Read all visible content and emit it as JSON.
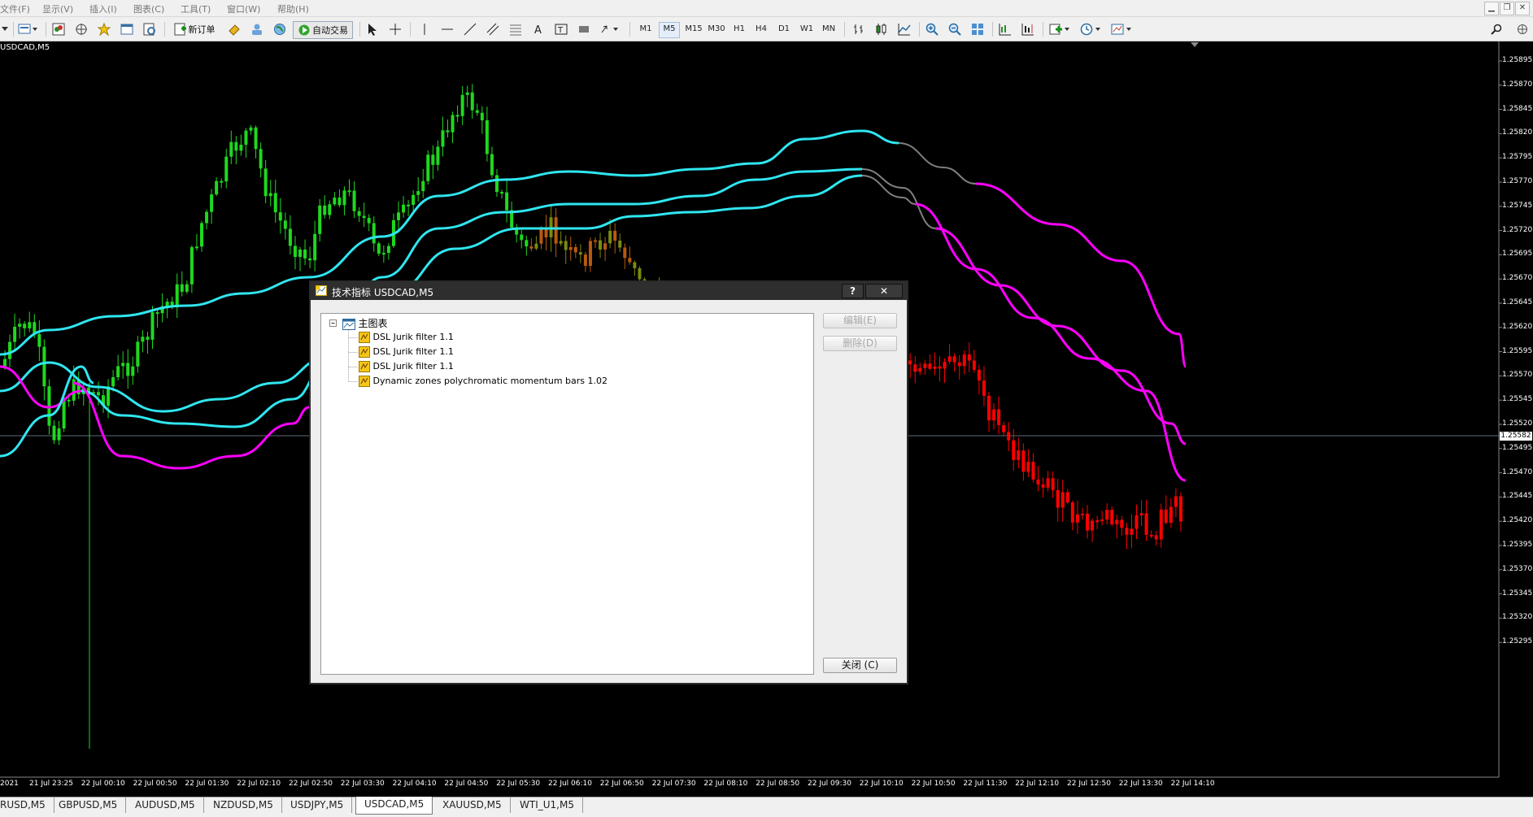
{
  "menu": {
    "items": [
      "文件(F)",
      "显示(V)",
      "插入(I)",
      "图表(C)",
      "工具(T)",
      "窗口(W)",
      "帮助(H)"
    ]
  },
  "toolbar": {
    "new_order_label": "新订单",
    "auto_trade_label": "自动交易",
    "timeframes": [
      "M1",
      "M5",
      "M15",
      "M30",
      "H1",
      "H4",
      "D1",
      "W1",
      "MN"
    ],
    "active_timeframe": "M5"
  },
  "chart": {
    "symbol_label": "USDCAD,M5",
    "current_price": "1.25582",
    "price_labels": [
      "1.25895",
      "1.25870",
      "1.25845",
      "1.25820",
      "1.25795",
      "1.25770",
      "1.25745",
      "1.25720",
      "1.25695",
      "1.25670",
      "1.25645",
      "1.25620",
      "1.25595",
      "1.25570",
      "1.25545",
      "1.25520",
      "1.25495",
      "1.25470",
      "1.25445",
      "1.25420",
      "1.25395",
      "1.25370",
      "1.25345",
      "1.25320",
      "1.25295"
    ],
    "time_labels": [
      "2021",
      "21 Jul 23:25",
      "22 Jul 00:10",
      "22 Jul 00:50",
      "22 Jul 01:30",
      "22 Jul 02:10",
      "22 Jul 02:50",
      "22 Jul 03:30",
      "22 Jul 04:10",
      "22 Jul 04:50",
      "22 Jul 05:30",
      "22 Jul 06:10",
      "22 Jul 06:50",
      "22 Jul 07:30",
      "22 Jul 08:10",
      "22 Jul 08:50",
      "22 Jul 09:30",
      "22 Jul 10:10",
      "22 Jul 10:50",
      "22 Jul 11:30",
      "22 Jul 12:10",
      "22 Jul 12:50",
      "22 Jul 13:30",
      "22 Jul 14:10"
    ],
    "colors": {
      "bull": "#1fd81f",
      "bear": "#ff0000",
      "mid_up": "#7a8a10",
      "mid_down": "#b85a10",
      "band_cyan": "#2fe6f0",
      "band_magenta": "#ff00ff",
      "band_gray": "#808080",
      "price_line": "#5a6a7a"
    }
  },
  "tabs": [
    "RUSD,M5",
    "GBPUSD,M5",
    "AUDUSD,M5",
    "NZDUSD,M5",
    "USDJPY,M5",
    "USDCAD,M5",
    "XAUUSD,M5",
    "WTI_U1,M5"
  ],
  "active_tab": "USDCAD,M5",
  "dialog": {
    "title": "技术指标 USDCAD,M5",
    "help_label": "?",
    "close_x_label": "✕",
    "tree_root": "主图表",
    "indicators": [
      "DSL Jurik filter 1.1",
      "DSL Jurik filter 1.1",
      "DSL Jurik filter 1.1",
      "Dynamic zones polychromatic momentum bars 1.02"
    ],
    "edit_label": "编辑(E)",
    "delete_label": "删除(D)",
    "close_label": "关闭 (C)"
  }
}
